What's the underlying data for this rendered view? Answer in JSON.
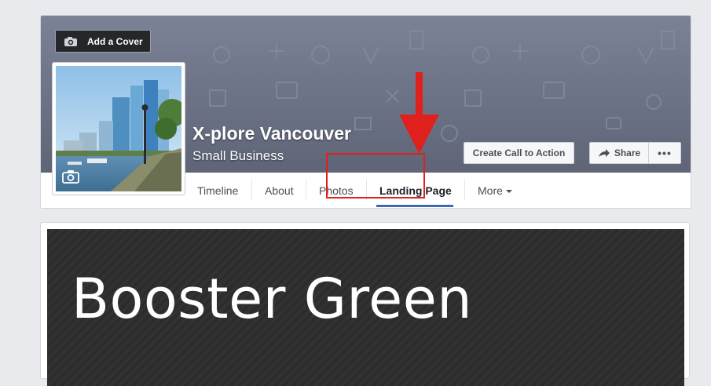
{
  "cover": {
    "add_cover_label": "Add a Cover"
  },
  "page": {
    "name": "X-plore Vancouver",
    "category": "Small Business"
  },
  "actions": {
    "cta_label": "Create Call to Action",
    "share_label": "Share",
    "more_label": "•••"
  },
  "tabs": [
    {
      "label": "Timeline"
    },
    {
      "label": "About"
    },
    {
      "label": "Photos"
    },
    {
      "label": "Landing Page",
      "active": true
    },
    {
      "label": "More"
    }
  ],
  "banner": {
    "title": "Booster Green"
  },
  "colors": {
    "highlight": "#e0201c",
    "tab_underline": "#4267b2",
    "arrow": "#e0201c"
  }
}
